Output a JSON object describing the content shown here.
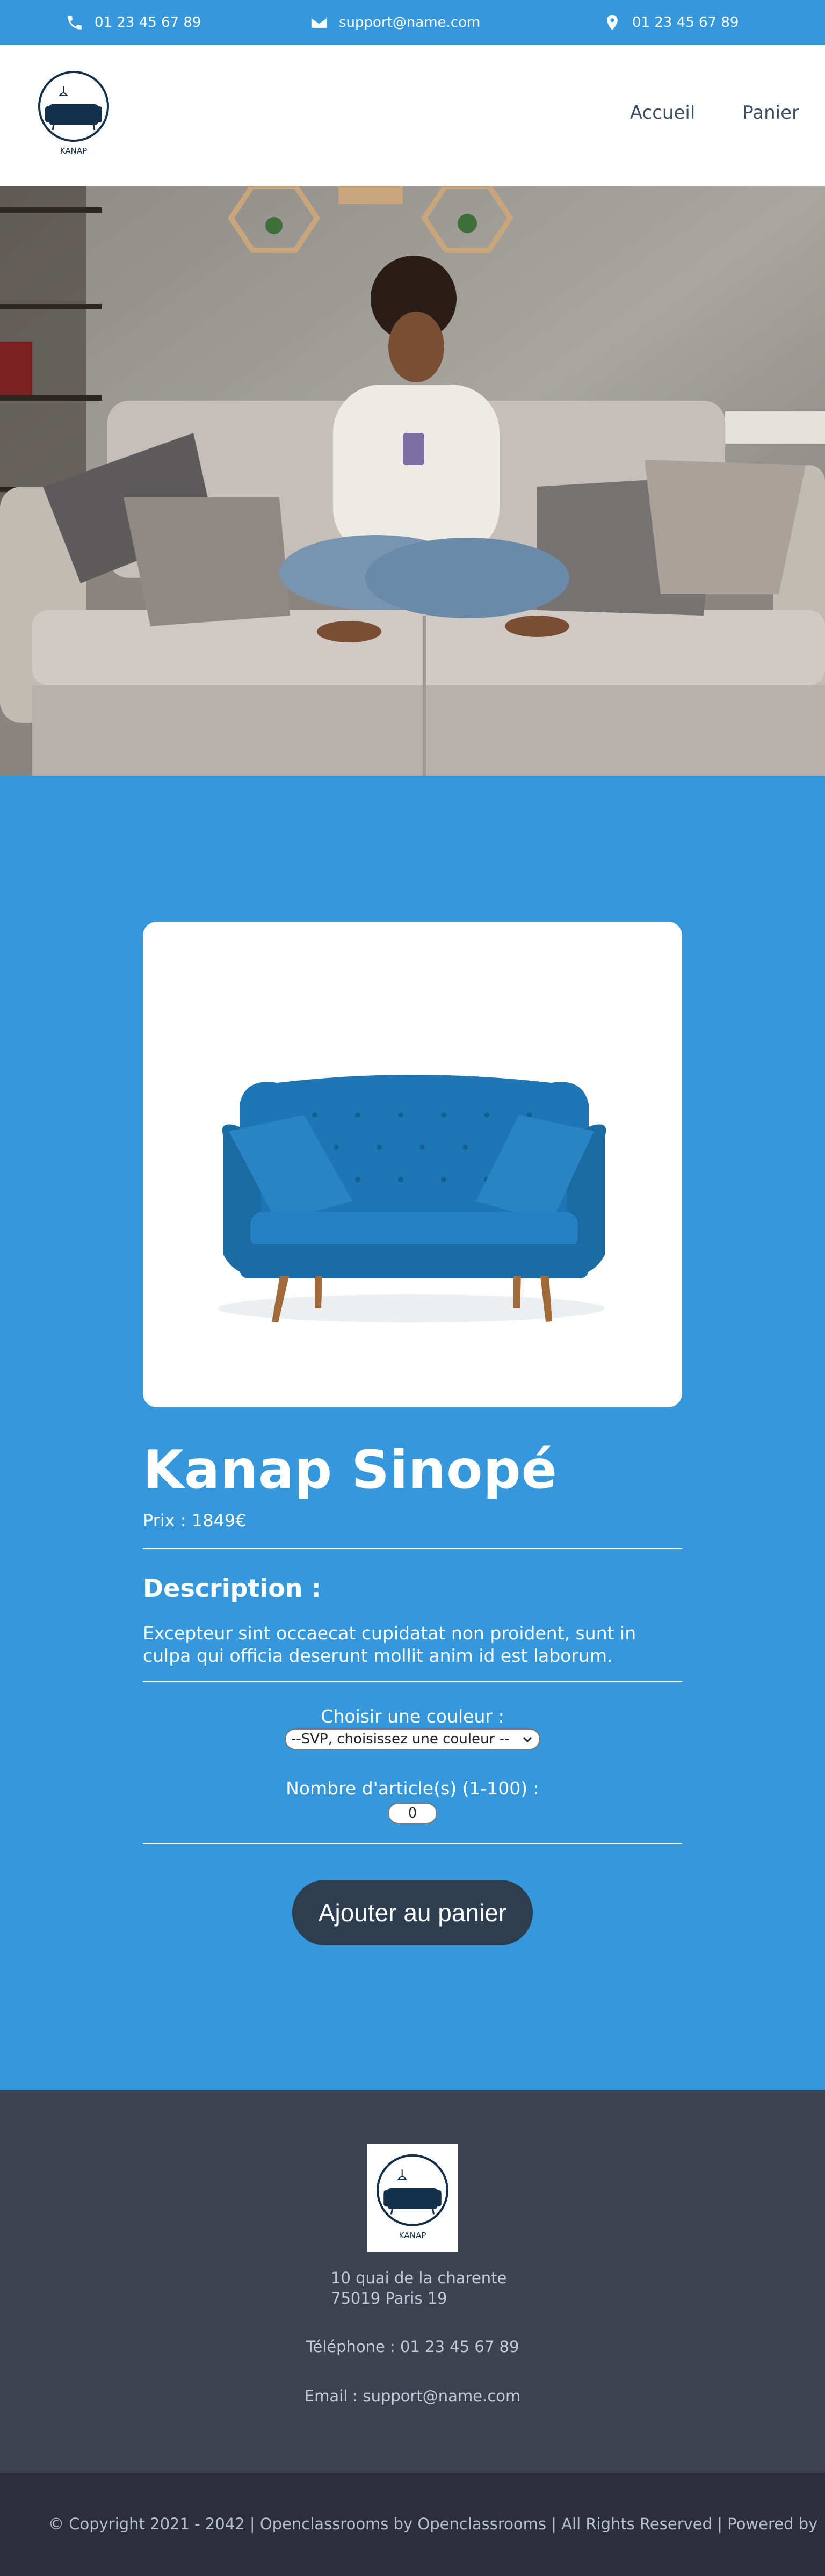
{
  "topbar": {
    "phone_icon": "phone-icon",
    "phone": "01 23 45 67 89",
    "email_icon": "envelope-icon",
    "email": "support@name.com",
    "pin_icon": "location-pin-icon",
    "phone2": "01 23 45 67 89"
  },
  "header": {
    "logo_text": "KANAP",
    "nav": [
      "Accueil",
      "Panier"
    ]
  },
  "product": {
    "title": "Kanap Sinopé",
    "price": "Prix : 1849€",
    "description_title": "Description :",
    "description": "Excepteur sint occaecat cupidatat non proident, sunt in culpa qui officia deserunt mollit anim id est laborum.",
    "color_label": "Choisir une couleur :",
    "color_select_value": "--SVP, choisissez une couleur --",
    "quantity_label": "Nombre d'article(s) (1-100) :",
    "quantity_value": "0",
    "add_button": "Ajouter au panier"
  },
  "footer": {
    "logo_text": "KANAP",
    "address_line1": "10 quai de la charente",
    "address_line2": "75019 Paris 19",
    "telephone": "Téléphone : 01 23 45 67 89",
    "email": "Email : support@name.com",
    "copyright": "© Copyright 2021 - 2042 | Openclassrooms by Openclassrooms | All Rights Reserved | Powered by"
  },
  "colors": {
    "accent": "#3498db",
    "dark": "#2c3e50",
    "footer": "#3d4150",
    "copyright_bar": "#2c2e3e"
  }
}
